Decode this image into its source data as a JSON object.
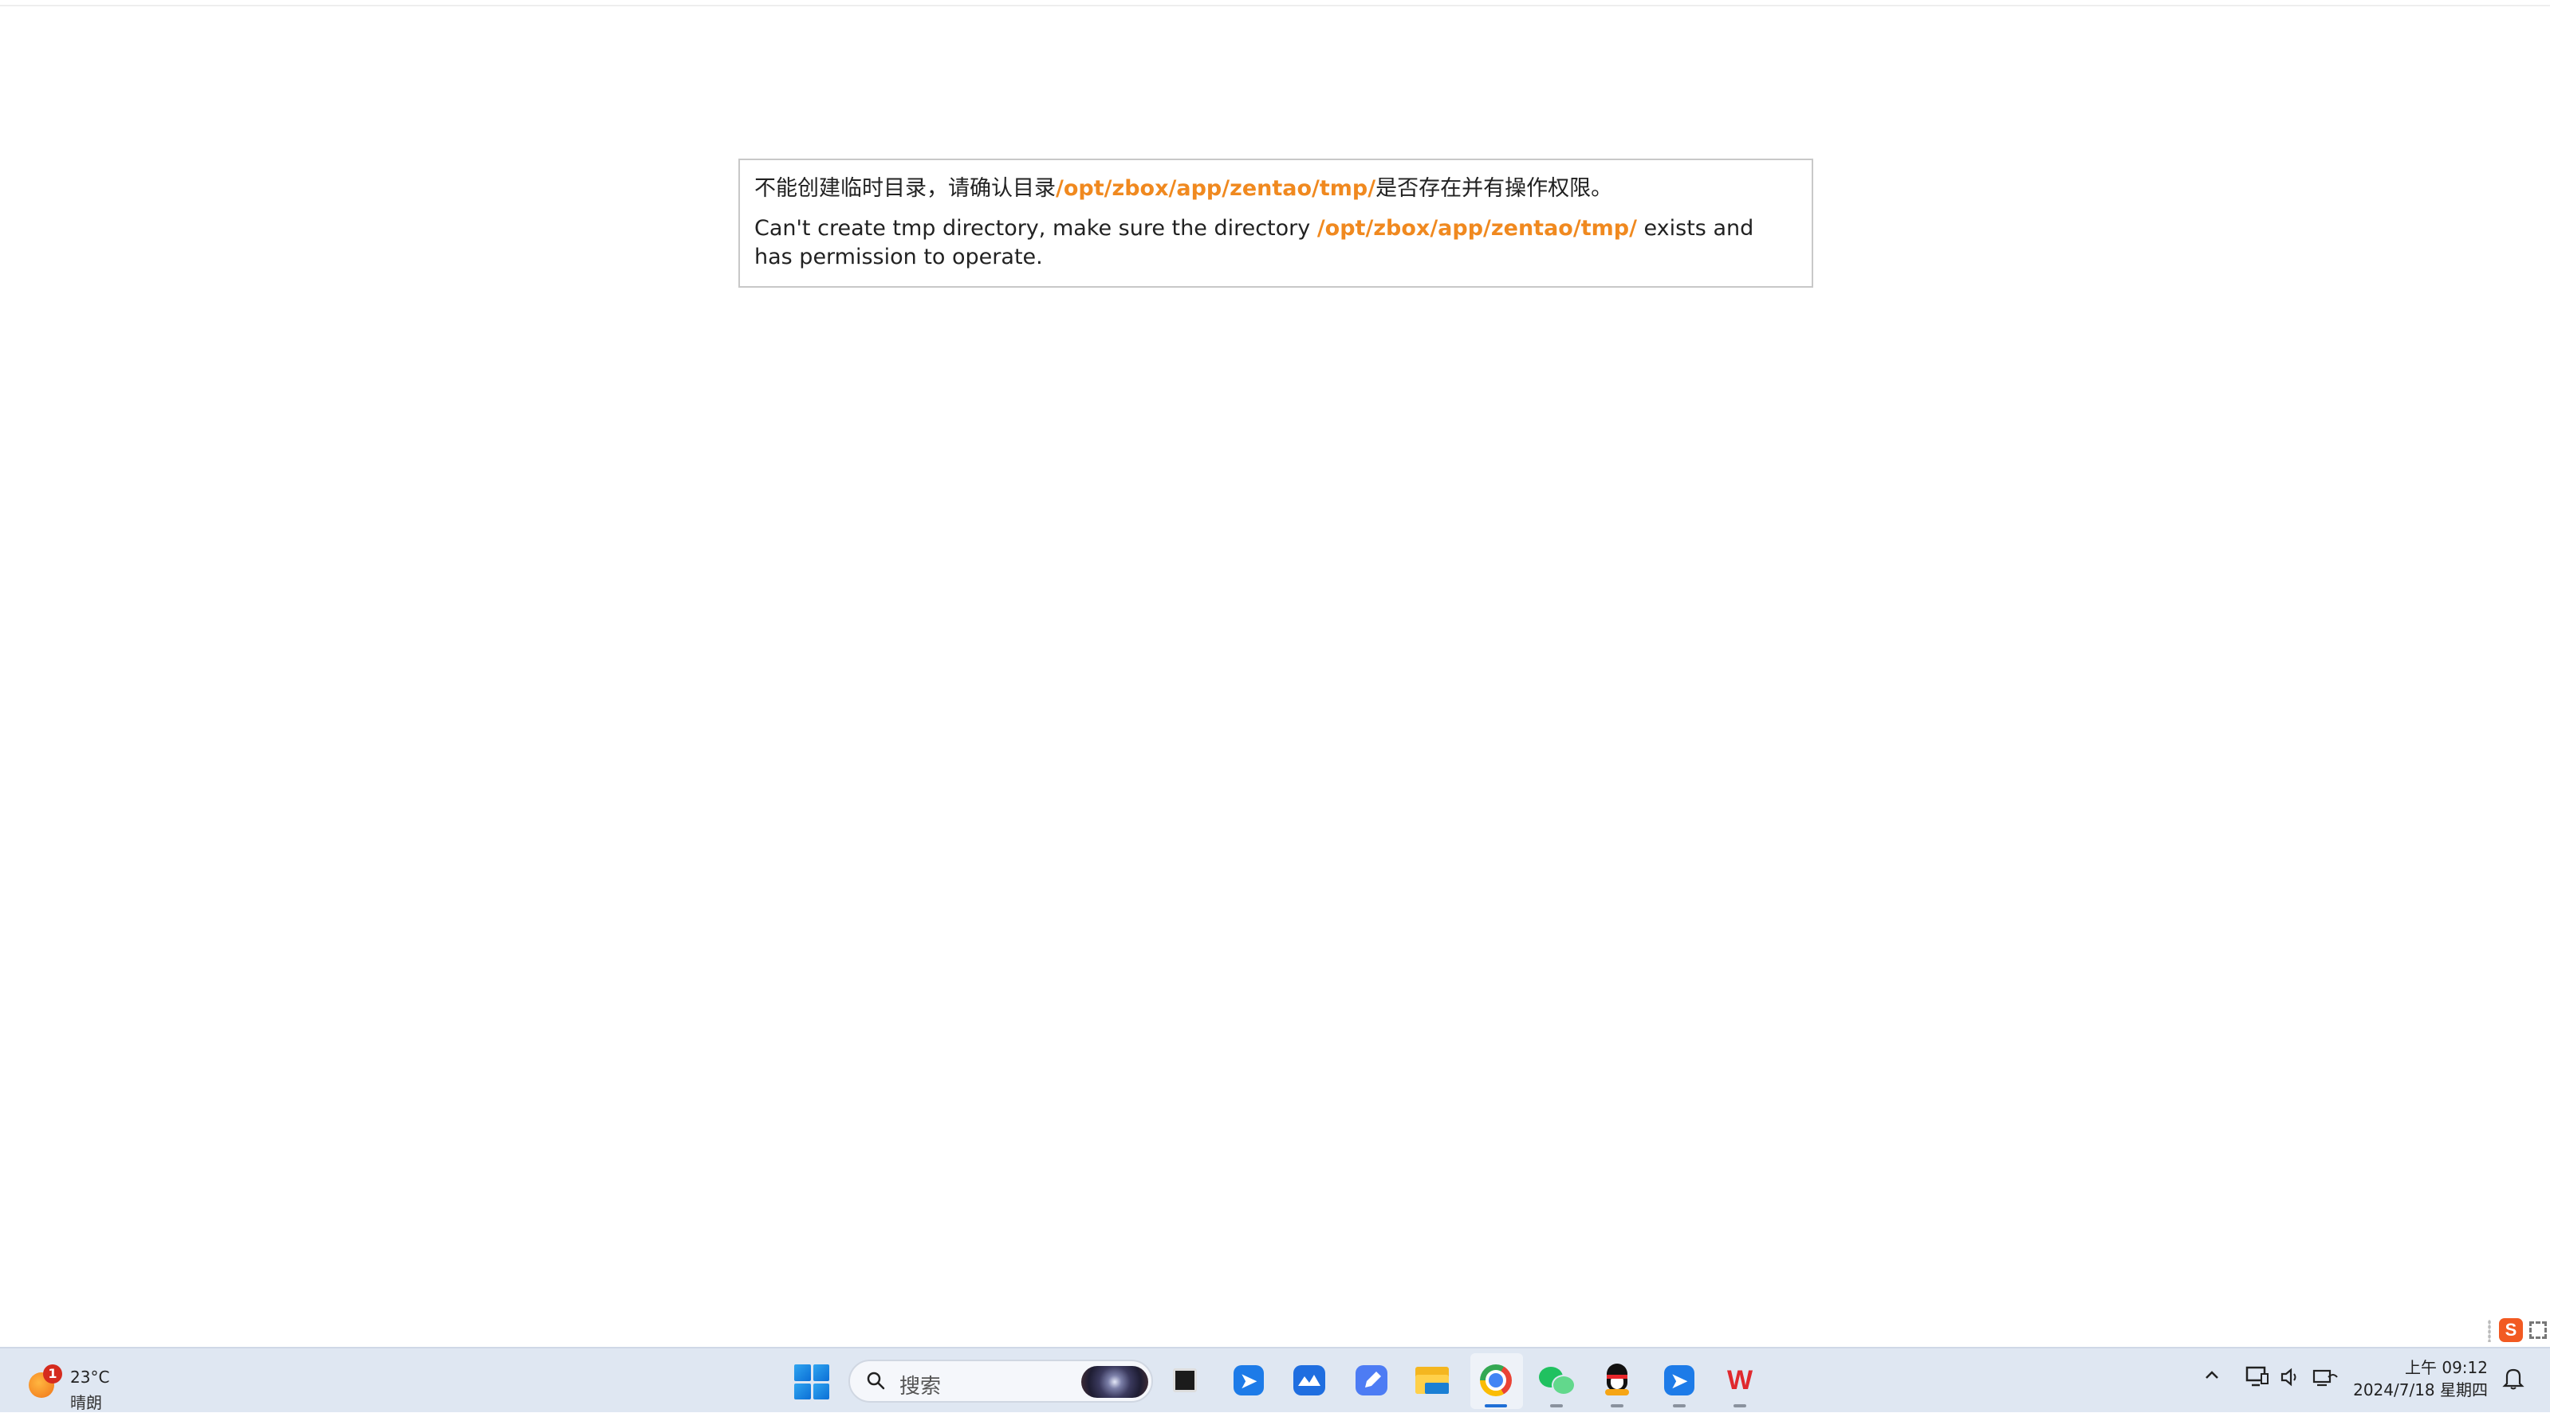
{
  "error": {
    "zh_prefix": "不能创建临时目录，请确认目录",
    "zh_path": "/opt/zbox/app/zentao/tmp/",
    "zh_suffix": "是否存在并有操作权限。",
    "en_prefix": "Can't create tmp directory, make sure the directory ",
    "en_path": "/opt/zbox/app/zentao/tmp/",
    "en_suffix": " exists and has permission to operate.",
    "path_color": "#f0891f"
  },
  "side_widget": {
    "sogou_glyph": "S",
    "icons": [
      "sogou-ime-icon",
      "expand-icon"
    ]
  },
  "taskbar": {
    "weather": {
      "badge": "1",
      "temperature": "23°C",
      "condition": "晴朗",
      "icon": "sun-icon"
    },
    "search": {
      "placeholder": "搜索"
    },
    "apps": [
      {
        "name": "start",
        "icon": "windows-start-icon"
      },
      {
        "name": "task-view",
        "icon": "task-view-icon"
      },
      {
        "name": "dingtalk",
        "icon": "dingtalk-icon"
      },
      {
        "name": "lark",
        "icon": "lark-icon"
      },
      {
        "name": "feishu-docs",
        "icon": "feishu-docs-icon"
      },
      {
        "name": "file-explorer",
        "icon": "folder-icon"
      },
      {
        "name": "chrome",
        "icon": "chrome-icon",
        "active": true
      },
      {
        "name": "wechat",
        "icon": "wechat-icon"
      },
      {
        "name": "qq",
        "icon": "qq-icon"
      },
      {
        "name": "dingtalk-2",
        "icon": "dingtalk-icon"
      },
      {
        "name": "wps",
        "icon": "wps-icon"
      }
    ],
    "tray": {
      "icons": [
        "chevron-up-icon",
        "display-icon",
        "volume-icon",
        "network-icon",
        "notification-bell-icon"
      ]
    },
    "clock": {
      "time": "上午 09:12",
      "date": "2024/7/18 星期四"
    }
  }
}
